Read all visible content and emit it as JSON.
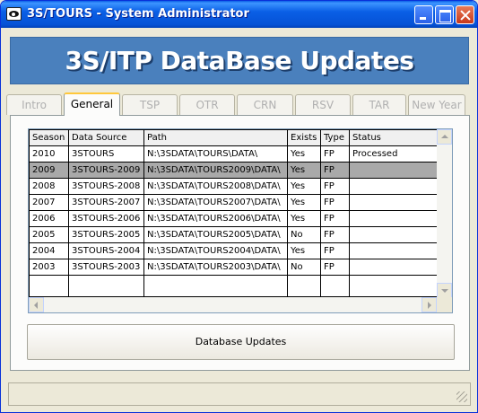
{
  "window": {
    "title": "3S/TOURS - System Administrator"
  },
  "banner": {
    "title": "3S/ITP DataBase Updates"
  },
  "tabs": [
    {
      "label": "Intro",
      "active": false
    },
    {
      "label": "General",
      "active": true
    },
    {
      "label": "TSP",
      "active": false
    },
    {
      "label": "OTR",
      "active": false
    },
    {
      "label": "CRN",
      "active": false
    },
    {
      "label": "RSV",
      "active": false
    },
    {
      "label": "TAR",
      "active": false
    },
    {
      "label": "New Year",
      "active": false
    }
  ],
  "grid": {
    "columns": [
      "Season",
      "Data Source",
      "Path",
      "Exists",
      "Type",
      "Status"
    ],
    "rows": [
      {
        "season": "2010",
        "source": "3STOURS",
        "path": "N:\\3SDATA\\TOURS\\DATA\\",
        "exists": "Yes",
        "type": "FP",
        "status": "Processed"
      },
      {
        "season": "2009",
        "source": "3STOURS-2009",
        "path": "N:\\3SDATA\\TOURS2009\\DATA\\",
        "exists": "Yes",
        "type": "FP",
        "status": ""
      },
      {
        "season": "2008",
        "source": "3STOURS-2008",
        "path": "N:\\3SDATA\\TOURS2008\\DATA\\",
        "exists": "Yes",
        "type": "FP",
        "status": ""
      },
      {
        "season": "2007",
        "source": "3STOURS-2007",
        "path": "N:\\3SDATA\\TOURS2007\\DATA\\",
        "exists": "Yes",
        "type": "FP",
        "status": ""
      },
      {
        "season": "2006",
        "source": "3STOURS-2006",
        "path": "N:\\3SDATA\\TOURS2006\\DATA\\",
        "exists": "Yes",
        "type": "FP",
        "status": ""
      },
      {
        "season": "2005",
        "source": "3STOURS-2005",
        "path": "N:\\3SDATA\\TOURS2005\\DATA\\",
        "exists": "No",
        "type": "FP",
        "status": ""
      },
      {
        "season": "2004",
        "source": "3STOURS-2004",
        "path": "N:\\3SDATA\\TOURS2004\\DATA\\",
        "exists": "Yes",
        "type": "FP",
        "status": ""
      },
      {
        "season": "2003",
        "source": "3STOURS-2003",
        "path": "N:\\3SDATA\\TOURS2003\\DATA\\",
        "exists": "No",
        "type": "FP",
        "status": ""
      }
    ],
    "selected_row": 1
  },
  "actions": {
    "update_label": "Database Updates"
  },
  "colors": {
    "banner": "#4a80bd",
    "titlebar": "#0a5fe6",
    "selected_row": "#a9a9a9",
    "active_tab_accent": "#ffc83c"
  },
  "icons": [
    "app-eye-icon",
    "minimize-icon",
    "maximize-icon",
    "close-icon",
    "scroll-up-icon",
    "scroll-down-icon",
    "scroll-left-icon",
    "scroll-right-icon",
    "resize-grip-icon"
  ]
}
